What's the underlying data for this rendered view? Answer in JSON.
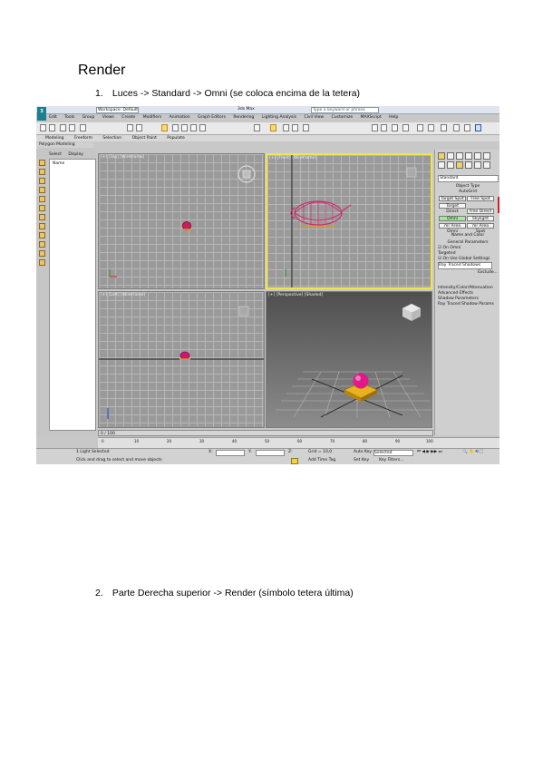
{
  "document": {
    "heading": "Render",
    "steps": [
      {
        "number": "1.",
        "text": "Luces -> Standard -> Omni (se coloca encima de la tetera)"
      },
      {
        "number": "2.",
        "text": "Parte Derecha superior -> Render (símbolo tetera última)"
      }
    ]
  },
  "screenshot": {
    "workspace": "Workspace: Default",
    "window_title": "3ds Max",
    "search_placeholder": "Type a keyword or phrase",
    "menu": [
      "Edit",
      "Tools",
      "Group",
      "Views",
      "Create",
      "Modifiers",
      "Animation",
      "Graph Editors",
      "Rendering",
      "Lighting Analysis",
      "Civil View",
      "Customize",
      "MAXScript",
      "Help"
    ],
    "ribbon_tabs": [
      "Modeling",
      "Freeform",
      "Selection",
      "Object Paint",
      "Populate"
    ],
    "ribbon_sub": "Polygon Modeling",
    "scene_explorer": {
      "tabs": [
        "Select",
        "Display"
      ],
      "items": [
        "Name"
      ]
    },
    "viewports": {
      "top": "[+] [Top] [Wireframe]",
      "front": "[+] [Front] [Wireframe]",
      "left": "[+] [Left] [Wireframe]",
      "perspective": "[+] [Perspective] [Shaded]"
    },
    "command_panel": {
      "dropdown": "Standard",
      "object_type": "Object Type",
      "autogrid": "AutoGrid",
      "buttons": [
        "Target Spot",
        "Free Spot",
        "Target Direct",
        "Free Direct",
        "Omni",
        "Skylight",
        "mr Area Omni",
        "mr Area Spot"
      ],
      "active_button": "Omni",
      "name_color": "Name and Color",
      "general_params": "General Parameters",
      "light_on": "On",
      "light_type": "Omni",
      "targeted": "Targeted",
      "shadows_on": "On",
      "use_global": "Use Global Settings",
      "shadow_type": "Ray Traced Shadows",
      "exclude": "Exclude...",
      "rollouts": [
        "Intensity/Color/Attenuation",
        "Advanced Effects",
        "Shadow Parameters",
        "Ray Traced Shadow Params"
      ]
    },
    "timeline": "0 / 100",
    "track_ticks": [
      "0",
      "10",
      "20",
      "30",
      "40",
      "50",
      "60",
      "70",
      "80",
      "90",
      "100"
    ],
    "status": {
      "selection": "1 Light Selected",
      "prompt": "Click and drag to select and move objects",
      "x_label": "X:",
      "y_label": "Y:",
      "z_label": "Z:",
      "grid": "Grid = 10,0",
      "auto_key": "Auto Key",
      "selected": "Selected",
      "set_key": "Set Key",
      "key_filters": "Key Filters...",
      "add_time_tag": "Add Time Tag"
    }
  }
}
